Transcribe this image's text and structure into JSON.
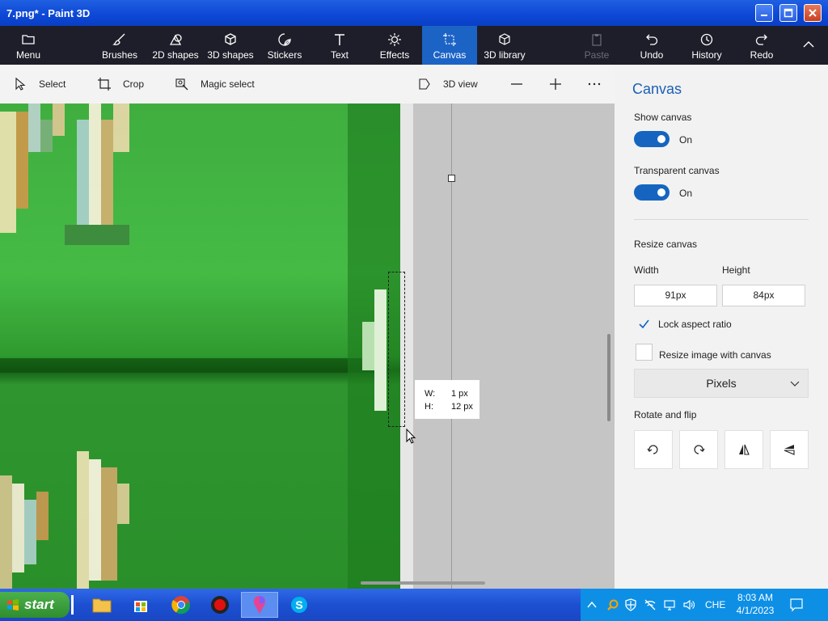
{
  "window": {
    "title": "7.png* - Paint 3D"
  },
  "ribbon": {
    "menu": "Menu",
    "items": [
      {
        "label": "Brushes",
        "icon": "brush-icon"
      },
      {
        "label": "2D shapes",
        "icon": "2d-shapes-icon"
      },
      {
        "label": "3D shapes",
        "icon": "3d-shapes-icon"
      },
      {
        "label": "Stickers",
        "icon": "stickers-icon"
      },
      {
        "label": "Text",
        "icon": "text-icon"
      },
      {
        "label": "Effects",
        "icon": "effects-icon"
      },
      {
        "label": "Canvas",
        "icon": "canvas-icon",
        "active": true
      },
      {
        "label": "3D library",
        "icon": "3d-library-icon"
      }
    ],
    "paste": "Paste",
    "undo": "Undo",
    "history": "History",
    "redo": "Redo",
    "active_color": "#1c63c6"
  },
  "toolbar": {
    "select": "Select",
    "crop": "Crop",
    "magic_select": "Magic select",
    "view_3d": "3D view"
  },
  "canvas": {
    "tooltip": {
      "w_label": "W:",
      "w_value": "1 px",
      "h_label": "H:",
      "h_value": "12 px"
    }
  },
  "panel": {
    "title": "Canvas",
    "show_canvas": {
      "label": "Show canvas",
      "state": "On"
    },
    "transparent_canvas": {
      "label": "Transparent canvas",
      "state": "On"
    },
    "resize_canvas": "Resize canvas",
    "width_label": "Width",
    "height_label": "Height",
    "width_value": "91px",
    "height_value": "84px",
    "lock_aspect": {
      "label": "Lock aspect ratio",
      "checked": true
    },
    "resize_image": {
      "label": "Resize image with canvas",
      "checked": false
    },
    "units": "Pixels",
    "rotate_flip": "Rotate and flip",
    "accent": "#1565c0"
  },
  "taskbar": {
    "start": "start",
    "language": "CHE",
    "time": "8:03 AM",
    "date": "4/1/2023"
  }
}
